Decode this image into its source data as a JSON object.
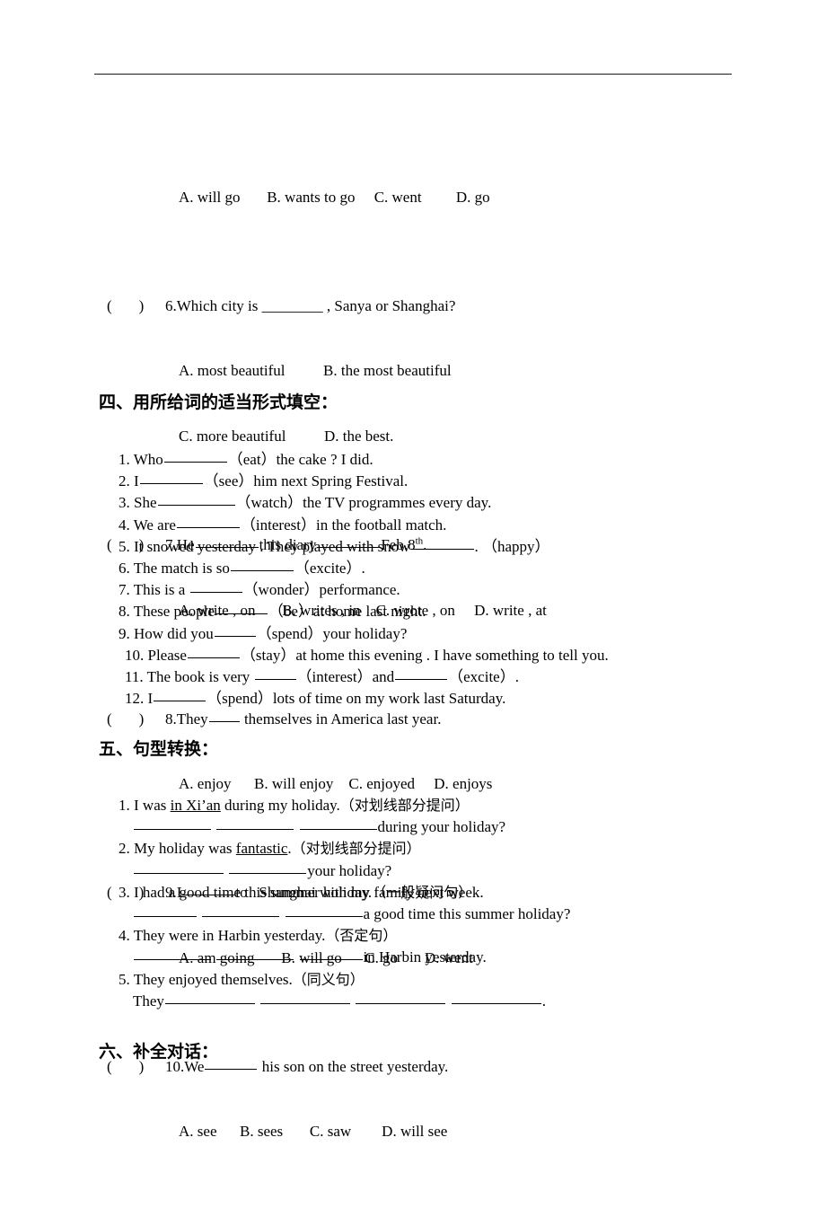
{
  "document": {
    "background": "#ffffff",
    "text_color": "#000000",
    "rule_color": "#1a1a1a"
  },
  "multiple_choice": {
    "continued_options_line": "A. will go       B. wants to go     C. went         D. go",
    "items": [
      {
        "marker_open": "(",
        "marker_close": ")",
        "number": "6.",
        "stem": "6.Which city is ________ , Sanya or Shanghai?",
        "option_lines": [
          "A. most beautiful          B. the most beautiful",
          "C. more beautiful          D. the best."
        ]
      },
      {
        "marker_open": "(",
        "marker_close": ")",
        "number": "7.",
        "stem_pre": "7.He",
        "stem_mid": "this diary",
        "stem_post": "Feb.8",
        "stem_sup": "th",
        "stem_end": ".",
        "option_lines": [
          "A. write , on       B. writes , in    C. wrote , on     D. write , at"
        ]
      },
      {
        "marker_open": "(",
        "marker_close": ")",
        "number": "8.",
        "stem_pre": "8.They",
        "stem_post": " themselves in America last year.",
        "option_lines": [
          "A. enjoy      B. will enjoy    C. enjoyed     D. enjoys"
        ]
      },
      {
        "marker_open": "(",
        "marker_close": ")",
        "number": "9.",
        "stem_pre": "9.I",
        "stem_post": "to   Shanghai with my family next week.",
        "option_lines": [
          "A. am going       B. will go      C. go       D. went"
        ]
      },
      {
        "marker_open": "(",
        "marker_close": ")",
        "number": "10.",
        "stem_pre": "10.We",
        "stem_post": " his son on the street yesterday.",
        "option_lines": [
          "A. see      B. sees       C. saw        D. will see"
        ]
      }
    ]
  },
  "section_four": {
    "heading": "四、用所给词的适当形式填空：",
    "items": [
      {
        "num": "1. ",
        "a": "Who",
        "b": "（eat）the cake ? I did."
      },
      {
        "num": "2. ",
        "a": "I",
        "b": "（see）him next Spring Festival."
      },
      {
        "num": "3. ",
        "a": "She",
        "b": "（watch）the TV programmes every day."
      },
      {
        "num": "4. ",
        "a": "We are",
        "b": "（interest）in the football match."
      },
      {
        "num": "5. ",
        "a": "It snowed yesterday . They played with snow",
        "b": ". （happy）"
      },
      {
        "num": "6. ",
        "a": "The match is so",
        "b": "（excite）."
      },
      {
        "num": "7. ",
        "a": "This is a ",
        "b": "（wonder）performance."
      },
      {
        "num": "8. ",
        "a": "These people",
        "b": "（be）at home last night."
      },
      {
        "num": "9. ",
        "a": "How did you",
        "b": "（spend）your holiday?"
      },
      {
        "num": "10. ",
        "a": "Please",
        "b": "（stay）at home this evening . I have something to tell you."
      },
      {
        "num": "11. ",
        "a": "The book is very ",
        "b": "（interest）and",
        "c": "（excite）."
      },
      {
        "num": "12. ",
        "a": "I",
        "b": "（spend）lots of time on my work last Saturday."
      }
    ]
  },
  "section_five": {
    "heading": "五、句型转换：",
    "items": [
      {
        "num": "1. ",
        "sentence_pre": "I was ",
        "sentence_underlined": "in Xi’an",
        "sentence_post": " during my holiday.",
        "instruction": "（对划线部分提问）",
        "answer_post": "during your holiday?",
        "blank_count": 3
      },
      {
        "num": "2. ",
        "sentence_pre": "My holiday was ",
        "sentence_underlined": "fantastic",
        "sentence_post": ".",
        "instruction": "（对划线部分提问）",
        "answer_post": "your holiday?",
        "blank_count": 2
      },
      {
        "num": "3. ",
        "sentence_pre": "I had a good time this summer holiday.",
        "sentence_underlined": "",
        "sentence_post": "",
        "instruction": "（一般疑问句）",
        "answer_post": "a good time this summer holiday?",
        "blank_count": 3
      },
      {
        "num": "4. ",
        "sentence_pre": "They were in Harbin yesterday.",
        "sentence_underlined": "",
        "sentence_post": "",
        "instruction": "（否定句）",
        "answer_post": "in Harbin yesterday.",
        "blank_count": 3
      },
      {
        "num": "5. ",
        "sentence_pre": "They enjoyed themselves.",
        "sentence_underlined": "",
        "sentence_post": "",
        "instruction": "（同义句）",
        "answer_pre": "They",
        "answer_post": ".",
        "blank_count": 4
      }
    ]
  },
  "section_six": {
    "heading": "六、补全对话："
  }
}
